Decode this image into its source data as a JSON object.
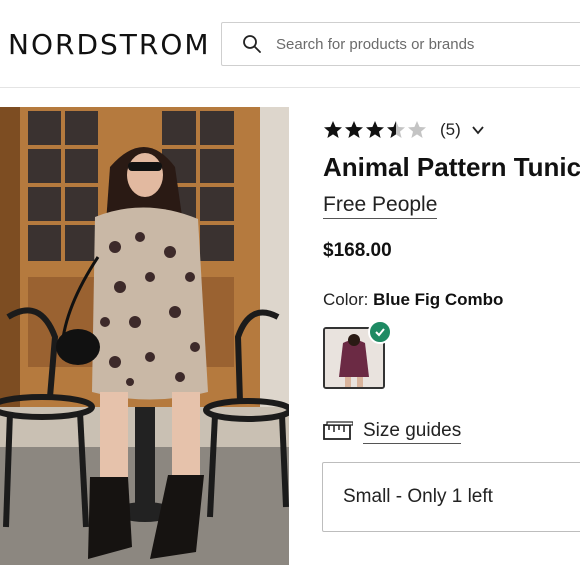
{
  "header": {
    "logo": "NORDSTROM",
    "search": {
      "placeholder": "Search for products or brands"
    }
  },
  "product": {
    "rating": 3.5,
    "rating_max": 5,
    "review_count": "(5)",
    "title": "Animal Pattern Tunic",
    "brand": "Free People",
    "price": "$168.00",
    "color_label": "Color:",
    "color_value": "Blue Fig Combo",
    "size_guides_label": "Size guides",
    "selected_size": "Small - Only 1 left"
  },
  "colors": {
    "accent_check": "#1e8a63",
    "text": "#111111"
  }
}
